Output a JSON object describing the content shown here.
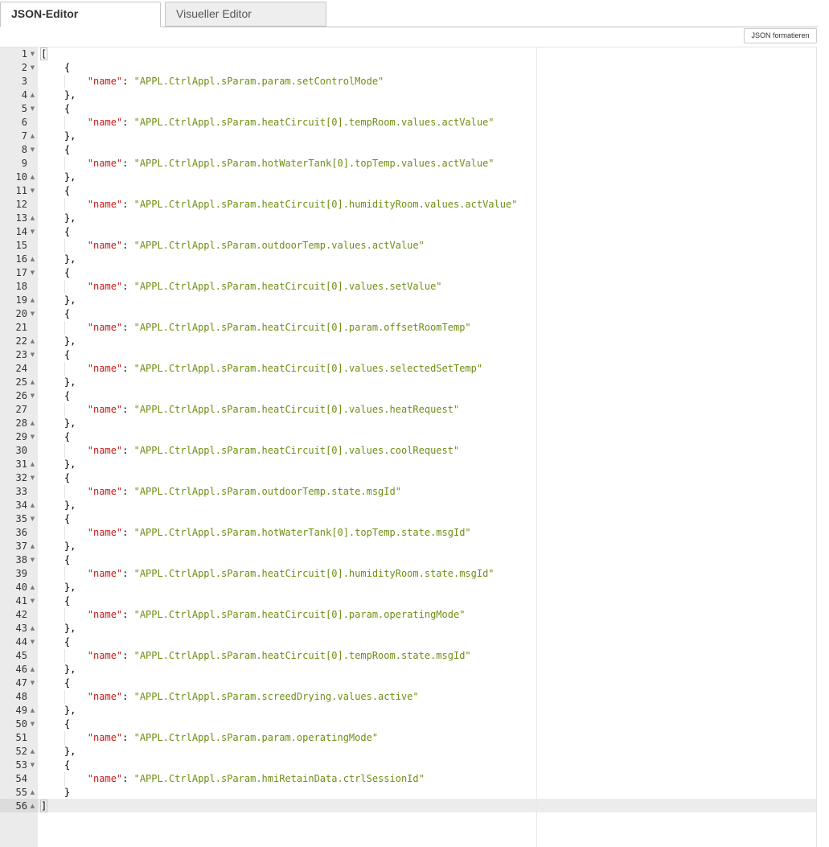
{
  "tabs": [
    {
      "label": "JSON-Editor",
      "active": true
    },
    {
      "label": "Visueller Editor",
      "active": false
    }
  ],
  "toolbar": {
    "format_label": "JSON formatieren"
  },
  "editor": {
    "key": "name",
    "active_line": 56,
    "names": [
      "APPL.CtrlAppl.sParam.param.setControlMode",
      "APPL.CtrlAppl.sParam.heatCircuit[0].tempRoom.values.actValue",
      "APPL.CtrlAppl.sParam.hotWaterTank[0].topTemp.values.actValue",
      "APPL.CtrlAppl.sParam.heatCircuit[0].humidityRoom.values.actValue",
      "APPL.CtrlAppl.sParam.outdoorTemp.values.actValue",
      "APPL.CtrlAppl.sParam.heatCircuit[0].values.setValue",
      "APPL.CtrlAppl.sParam.heatCircuit[0].param.offsetRoomTemp",
      "APPL.CtrlAppl.sParam.heatCircuit[0].values.selectedSetTemp",
      "APPL.CtrlAppl.sParam.heatCircuit[0].values.heatRequest",
      "APPL.CtrlAppl.sParam.heatCircuit[0].values.coolRequest",
      "APPL.CtrlAppl.sParam.outdoorTemp.state.msgId",
      "APPL.CtrlAppl.sParam.hotWaterTank[0].topTemp.state.msgId",
      "APPL.CtrlAppl.sParam.heatCircuit[0].humidityRoom.state.msgId",
      "APPL.CtrlAppl.sParam.heatCircuit[0].param.operatingMode",
      "APPL.CtrlAppl.sParam.heatCircuit[0].tempRoom.state.msgId",
      "APPL.CtrlAppl.sParam.screedDrying.values.active",
      "APPL.CtrlAppl.sParam.param.operatingMode",
      "APPL.CtrlAppl.sParam.hmiRetainData.ctrlSessionId"
    ],
    "icons": {
      "fold_open": "fold-open-icon",
      "fold_close": "fold-close-icon"
    }
  }
}
